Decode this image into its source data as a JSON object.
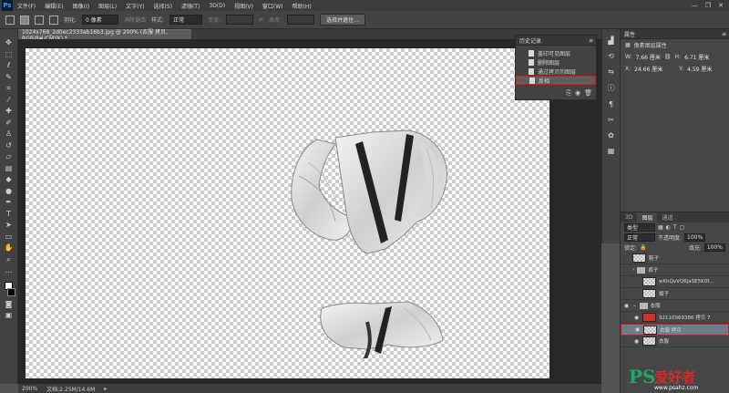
{
  "menubar": {
    "logo": "Ps",
    "items": [
      "文件(F)",
      "编辑(E)",
      "图像(I)",
      "图层(L)",
      "文字(Y)",
      "选择(S)",
      "滤镜(T)",
      "3D(D)",
      "视图(V)",
      "窗口(W)",
      "帮助(H)"
    ],
    "controls": [
      "—",
      "❐",
      "✕"
    ]
  },
  "options": {
    "feather_label": "羽化:",
    "feather_value": "0 像素",
    "antialias_label": "消除锯齿",
    "style_label": "样式:",
    "style_value": "正常",
    "width_label": "宽度:",
    "height_label": "高度:",
    "select_mask_button": "选择并遮住..."
  },
  "document": {
    "tab_title": "1024x768_2d0ec2333ab16b3.jpg @ 200% (衣服 拷贝, RGB/8#/CMYK) *",
    "zoom": "200%",
    "doc_size": "文档:2.25M/14.6M"
  },
  "history": {
    "title": "历史记录",
    "items": [
      {
        "label": "盖印可见图层",
        "active": false
      },
      {
        "label": "删除图层",
        "active": false
      },
      {
        "label": "通过拷贝的图层",
        "active": false
      },
      {
        "label": "反相",
        "active": true
      }
    ]
  },
  "properties": {
    "title": "属性",
    "subtitle": "像素图层属性",
    "w_label": "W:",
    "w_value": "7.66 厘米",
    "h_label": "H:",
    "h_value": "6.71 厘米",
    "x_label": "X:",
    "x_value": "24.66 厘米",
    "y_label": "Y:",
    "y_value": "4.59 厘米"
  },
  "layers": {
    "tabs": [
      "3D",
      "图层",
      "通道"
    ],
    "active_tab": "图层",
    "kind_filter": "类型",
    "blend_mode": "正常",
    "opacity_label": "不透明度:",
    "opacity_value": "100%",
    "lock_label": "锁定:",
    "fill_label": "填充:",
    "fill_value": "100%",
    "rows": [
      {
        "name": "鞋子",
        "type": "layer",
        "visible": false,
        "selected": false
      },
      {
        "name": "裤子",
        "type": "group",
        "visible": false,
        "selected": false
      },
      {
        "name": "wKhQvVQ6jaSE5K0f...",
        "type": "layer",
        "visible": false,
        "selected": false
      },
      {
        "name": "裤子",
        "type": "layer",
        "visible": false,
        "selected": false
      },
      {
        "name": "衣服",
        "type": "group",
        "visible": true,
        "selected": false
      },
      {
        "name": "92110969386 拷贝 7",
        "type": "layer",
        "visible": true,
        "selected": false
      },
      {
        "name": "衣服 拷贝",
        "type": "layer",
        "visible": true,
        "selected": true
      },
      {
        "name": "衣服",
        "type": "layer",
        "visible": true,
        "selected": false
      }
    ]
  },
  "watermark": {
    "logo": "PS",
    "name": "爱好者",
    "url": "www.psahz.com"
  },
  "colors": {
    "highlight_red": "#e01515",
    "canvas_checker": "#cccccc"
  }
}
